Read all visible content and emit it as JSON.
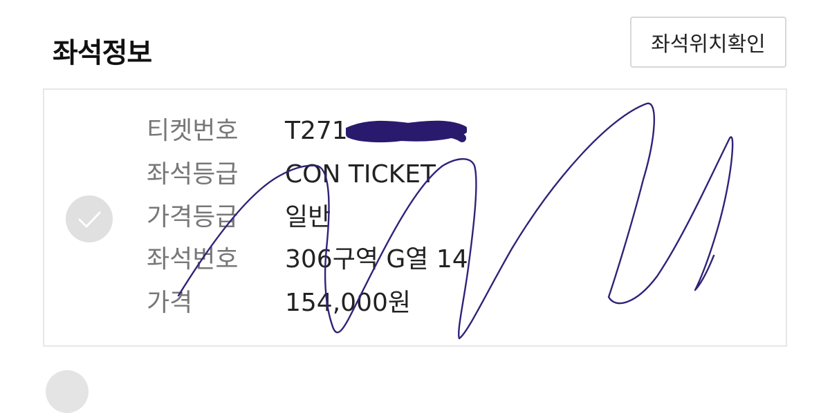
{
  "section": {
    "title": "좌석정보",
    "seat_location_button": "좌석위치확인"
  },
  "ticket": {
    "rows": [
      {
        "label": "티켓번호",
        "value": "T271"
      },
      {
        "label": "좌석등급",
        "value": "CON TICKET"
      },
      {
        "label": "가격등급",
        "value": "일반"
      },
      {
        "label": "좌석번호",
        "value": "306구역 G열 14"
      },
      {
        "label": "가격",
        "value": "154,000원"
      }
    ],
    "selected": true
  },
  "annotations": {
    "redaction_color": "#2a1a6e",
    "scribble_color": "#2e2378"
  },
  "icons": {
    "check": "check-icon"
  }
}
